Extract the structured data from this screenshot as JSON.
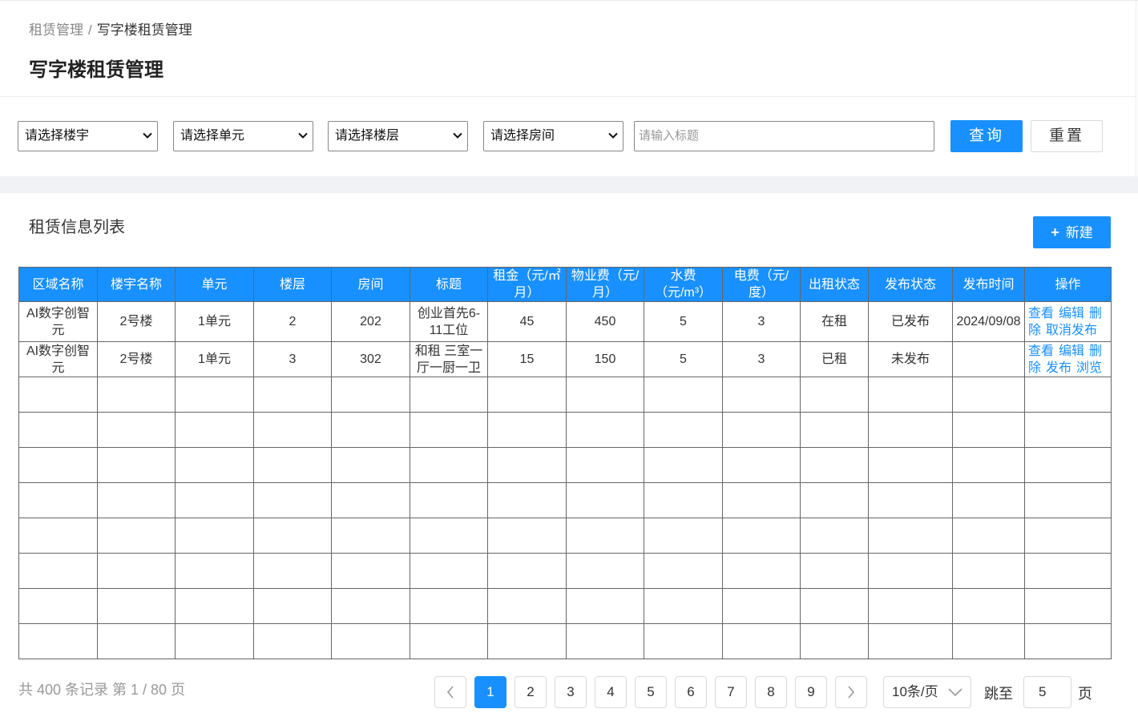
{
  "breadcrumb": {
    "parent": "租赁管理",
    "separator": "/",
    "current": "写字楼租赁管理"
  },
  "page_title": "写字楼租赁管理",
  "filters": {
    "building_select": "请选择楼宇",
    "unit_select": "请选择单元",
    "floor_select": "请选择楼层",
    "room_select": "请选择房间",
    "title_placeholder": "请输入标题",
    "query_label": "查询",
    "reset_label": "重置"
  },
  "list": {
    "title": "租赁信息列表",
    "new_button": "新建",
    "columns": [
      "区域名称",
      "楼宇名称",
      "单元",
      "楼层",
      "房间",
      "标题",
      "租金（元/㎡月）",
      "物业费（元/月）",
      "水费（元/m³）",
      "电费（元/度）",
      "出租状态",
      "发布状态",
      "发布时间",
      "操作"
    ],
    "rows": [
      {
        "area": "AI数字创智元",
        "building": "2号楼",
        "unit": "1单元",
        "floor": "2",
        "room": "202",
        "title": "创业首先6-11工位",
        "rent": "45",
        "property_fee": "450",
        "water_fee": "5",
        "electric_fee": "3",
        "rent_status": "在租",
        "publish_status": "已发布",
        "publish_time": "2024/09/08",
        "ops": [
          "查看",
          "编辑",
          "删除",
          "取消发布"
        ]
      },
      {
        "area": "AI数字创智元",
        "building": "2号楼",
        "unit": "1单元",
        "floor": "3",
        "room": "302",
        "title": "和租 三室一厅一厨一卫",
        "rent": "15",
        "property_fee": "150",
        "water_fee": "5",
        "electric_fee": "3",
        "rent_status": "已租",
        "publish_status": "未发布",
        "publish_time": "",
        "ops": [
          "查看",
          "编辑",
          "删除",
          "发布",
          "浏览"
        ]
      }
    ]
  },
  "pagination": {
    "summary": "共 400 条记录 第 1 / 80 页",
    "pages": [
      "1",
      "2",
      "3",
      "4",
      "5",
      "6",
      "7",
      "8",
      "9"
    ],
    "current": "1",
    "page_size": "10条/页",
    "jump_label": "跳至",
    "jump_value": "5",
    "page_suffix": "页"
  },
  "colors": {
    "primary": "#1890ff",
    "band": "#f0f2f5"
  }
}
